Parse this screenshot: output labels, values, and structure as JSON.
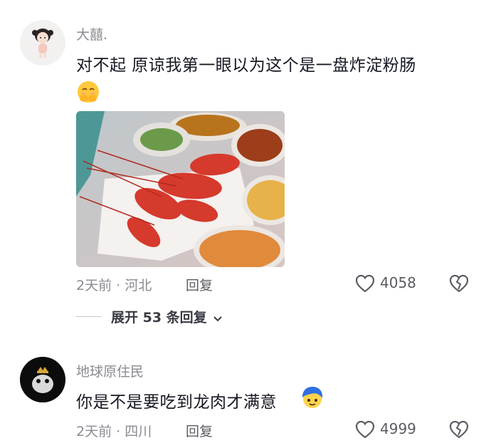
{
  "comments": [
    {
      "username": "大囍.",
      "text": "对不起 原谅我第一眼以为这个是一盘炸淀粉肠",
      "emoji": "pleading-hands-emoji",
      "meta": "2天前 · 河北",
      "reply_label": "回复",
      "likes": "4058",
      "expand_label": "展开 53 条回复"
    },
    {
      "username": "地球原住民",
      "text": "你是不是要吃到龙肉才满意",
      "emoji": "blue-hair-face-emoji",
      "meta": "2天前 · 四川",
      "reply_label": "回复",
      "likes": "4999"
    }
  ],
  "colors": {
    "username": "#8a8b91",
    "text": "#161823",
    "meta": "#8a8b91"
  }
}
